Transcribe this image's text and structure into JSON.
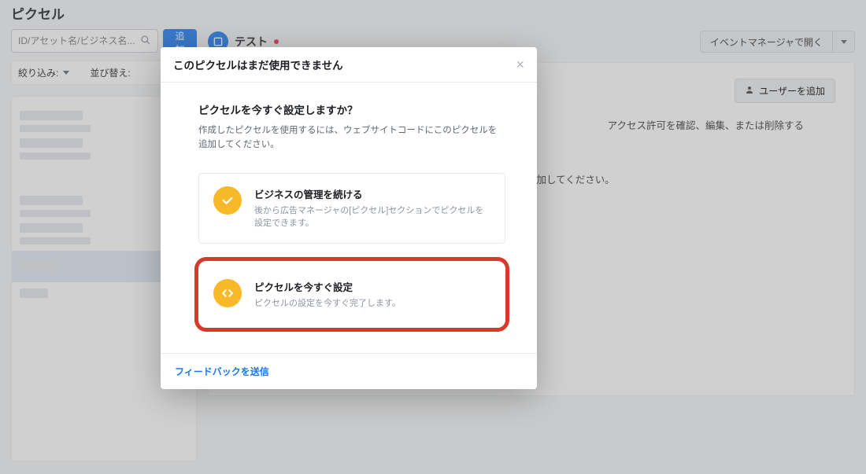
{
  "page": {
    "title": "ピクセル"
  },
  "search": {
    "placeholder": "ID/アセット名/ビジネス名...",
    "add_label": "追加"
  },
  "filters": {
    "filter_label": "絞り込み:",
    "sort_label": "並び替え:"
  },
  "asset": {
    "name": "テスト",
    "open_label": "イベントマネージャで開く"
  },
  "users": {
    "add_user_label": "ユーザーを追加",
    "desc_line": "アクセス許可を確認、編集、または削除する",
    "empty_line": "せん。ユーザーを追加してください。"
  },
  "modal": {
    "title": "このピクセルはまだ使用できません",
    "question": "ピクセルを今すぐ設定しますか？",
    "question_desc": "作成したピクセルを使用するには、ウェブサイトコードにこのピクセルを追加してください。",
    "option1_title": "ビジネスの管理を続ける",
    "option1_desc": "後から広告マネージャの[ピクセル]セクションでピクセルを設定できます。",
    "option2_title": "ピクセルを今すぐ設定",
    "option2_desc": "ピクセルの設定を今すぐ完了します。",
    "feedback": "フィードバックを送信"
  }
}
